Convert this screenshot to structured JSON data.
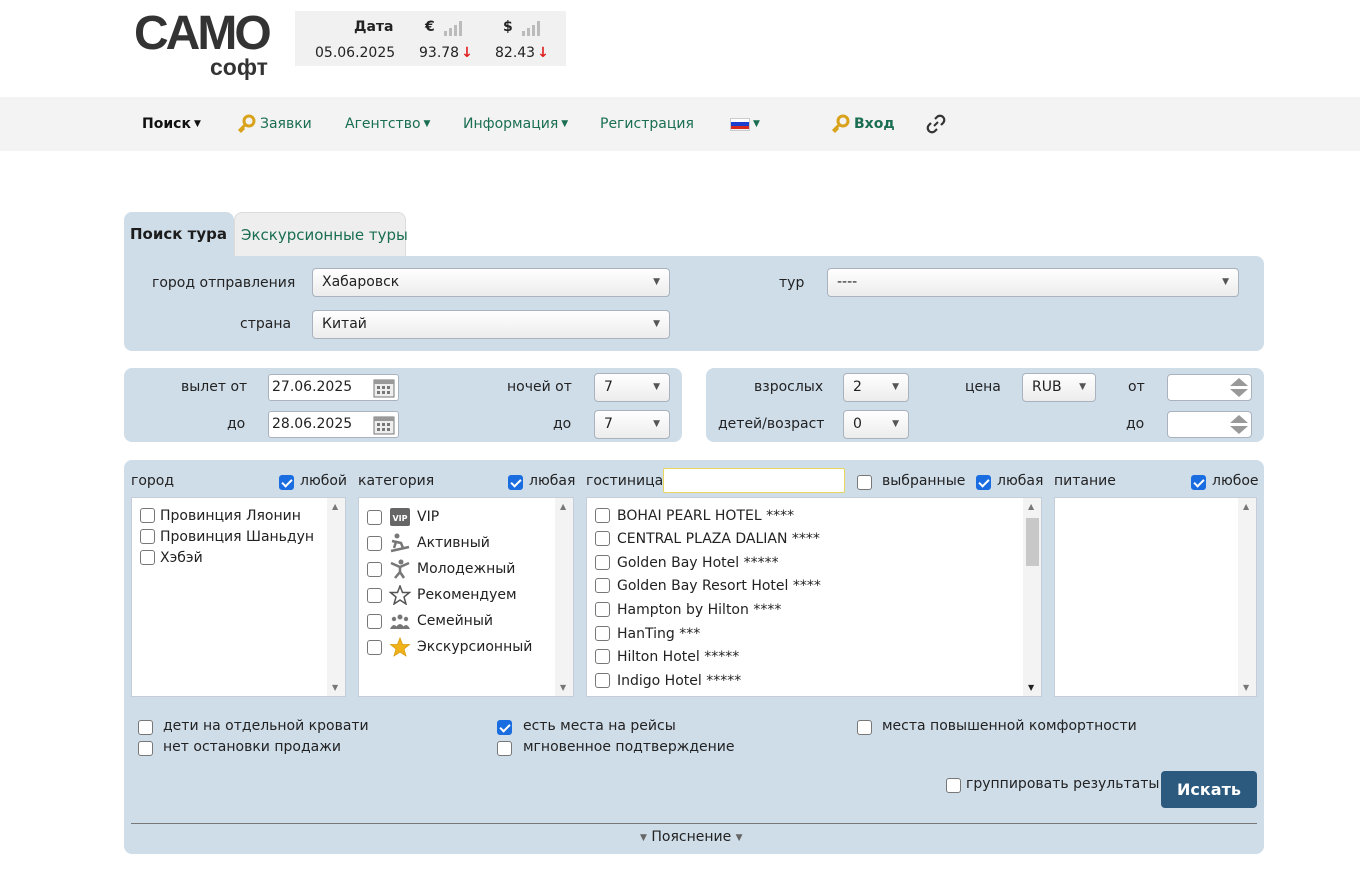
{
  "logo": {
    "main": "CAMO",
    "sub": "софт"
  },
  "rates": {
    "date_header": "Дата",
    "date_value": "05.06.2025",
    "eur_symbol": "€",
    "eur_value": "93.78",
    "usd_symbol": "$",
    "usd_value": "82.43",
    "trend_arrow": "↓"
  },
  "nav": {
    "search": "Поиск",
    "orders": "Заявки",
    "agency": "Агентство",
    "info": "Информация",
    "register": "Регистрация",
    "login": "Вход"
  },
  "tabs": {
    "tour_search": "Поиск тура",
    "excursion": "Экскурсионные туры"
  },
  "route": {
    "departure_city_label": "город отправления",
    "departure_city_value": "Хабаровск",
    "country_label": "страна",
    "country_value": "Китай",
    "tour_label": "тур",
    "tour_value": "----"
  },
  "dates": {
    "from_label": "вылет от",
    "from_value": "27.06.2025",
    "to_label": "до",
    "to_value": "28.06.2025",
    "nights_from_label": "ночей от",
    "nights_from_value": "7",
    "nights_to_label": "до",
    "nights_to_value": "7"
  },
  "people": {
    "adults_label": "взрослых",
    "adults_value": "2",
    "children_label": "детей/возраст",
    "children_value": "0",
    "price_label": "цена",
    "currency_value": "RUB",
    "price_from_label": "от",
    "price_to_label": "до"
  },
  "filters": {
    "city_label": "город",
    "city_any": "любой",
    "cities": [
      "Провинция Ляонин",
      "Провинция Шаньдун",
      "Хэбэй"
    ],
    "category_label": "категория",
    "category_any": "любая",
    "categories": [
      "VIP",
      "Активный",
      "Молодежный",
      "Рекомендуем",
      "Семейный",
      "Экскурсионный"
    ],
    "hotel_label": "гостиница",
    "hotel_selected": "выбранные",
    "hotel_any": "любая",
    "hotels": [
      "BOHAI PEARL HOTEL ****",
      "CENTRAL PLAZA DALIAN ****",
      "Golden Bay Hotel *****",
      "Golden Bay Resort Hotel ****",
      "Hampton by Hilton ****",
      "HanTing ***",
      "Hilton Hotel *****",
      "Indigo Hotel *****"
    ],
    "meal_label": "питание",
    "meal_any": "любое"
  },
  "options": {
    "separate_bed": "дети на отдельной кровати",
    "no_stop_sale": "нет остановки продажи",
    "flight_seats": "есть места на рейсы",
    "instant_confirm": "мгновенное подтверждение",
    "comfort_seats": "места повышенной комфортности",
    "group_results": "группировать результаты"
  },
  "search_button": "Искать",
  "explanation": "Пояснение",
  "colors": {
    "panel_bg": "#cfdde9",
    "link_green": "#1a6e52",
    "button_blue": "#2b5a7e",
    "checkbox_blue": "#1a6de0"
  }
}
